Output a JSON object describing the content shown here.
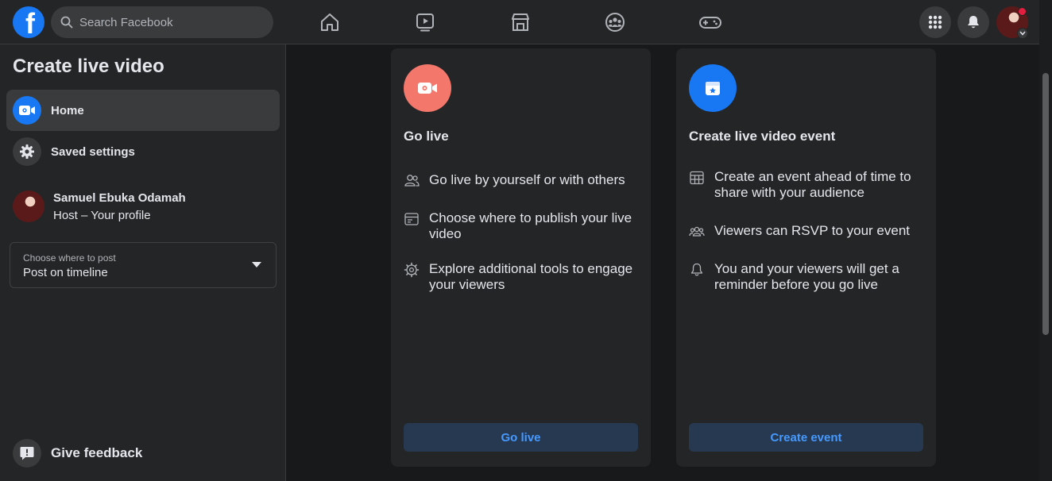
{
  "topbar": {
    "logo_letter": "f",
    "search_placeholder": "Search Facebook",
    "nav_icons": [
      "home-icon",
      "watch-icon",
      "marketplace-icon",
      "groups-icon",
      "gaming-icon"
    ],
    "right_icons": [
      "menu-grid-icon",
      "notifications-bell-icon",
      "profile-avatar"
    ]
  },
  "sidebar": {
    "title": "Create live video",
    "items": [
      {
        "label": "Home",
        "icon": "live-camera-icon",
        "active": true
      },
      {
        "label": "Saved settings",
        "icon": "gear-icon",
        "active": false
      }
    ],
    "host": {
      "name": "Samuel Ebuka Odamah",
      "subtitle": "Host – Your profile"
    },
    "post_select": {
      "label": "Choose where to post",
      "value": "Post on timeline"
    },
    "feedback_label": "Give feedback"
  },
  "cards": [
    {
      "title": "Go live",
      "icon": "live-video-icon",
      "features": [
        {
          "icon": "people-icon",
          "text": "Go live by yourself or with others"
        },
        {
          "icon": "publish-window-icon",
          "text": "Choose where to publish your live video"
        },
        {
          "icon": "gear-icon",
          "text": "Explore additional tools to engage your viewers"
        }
      ],
      "button_label": "Go live"
    },
    {
      "title": "Create live video event",
      "icon": "calendar-star-icon",
      "features": [
        {
          "icon": "calendar-grid-icon",
          "text": "Create an event ahead of time to share with your audience"
        },
        {
          "icon": "people-group-icon",
          "text": "Viewers can RSVP to your event"
        },
        {
          "icon": "bell-icon",
          "text": "You and your viewers will get a reminder before you go live"
        }
      ],
      "button_label": "Create event"
    }
  ],
  "colors": {
    "brand_blue": "#1877f2",
    "live_red": "#f3776b",
    "button_bg": "#263951",
    "button_text": "#4599ff",
    "notification_dot": "#e41e3f"
  }
}
